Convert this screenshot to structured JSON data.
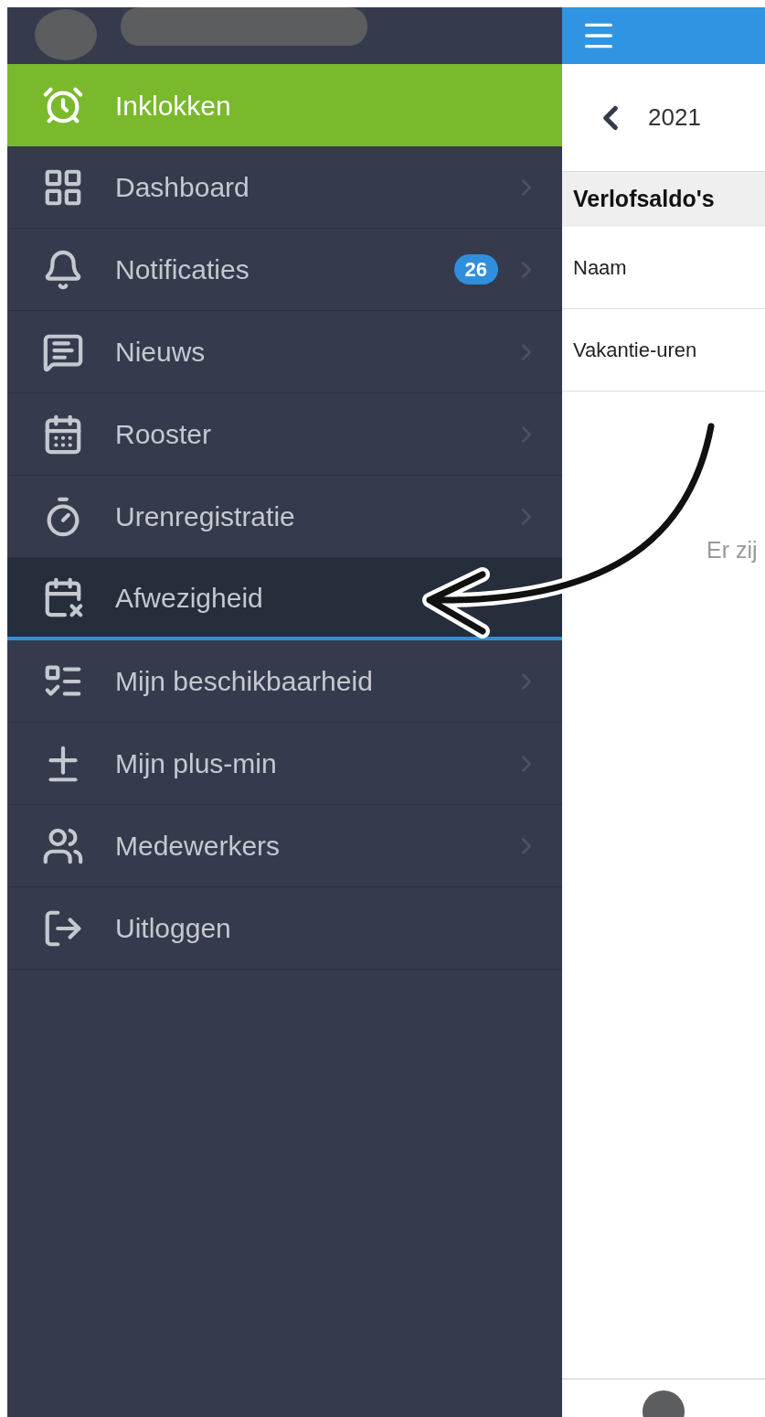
{
  "menu": {
    "items": [
      {
        "kind": "action",
        "label": "Inklokken",
        "selected": false
      },
      {
        "kind": "nav",
        "label": "Dashboard",
        "selected": false
      },
      {
        "kind": "nav",
        "label": "Notificaties",
        "badge": "26",
        "selected": false
      },
      {
        "kind": "nav",
        "label": "Nieuws",
        "selected": false
      },
      {
        "kind": "nav",
        "label": "Rooster",
        "selected": false
      },
      {
        "kind": "nav",
        "label": "Urenregistratie",
        "selected": false
      },
      {
        "kind": "nav",
        "label": "Afwezigheid",
        "selected": true
      },
      {
        "kind": "nav",
        "label": "Mijn beschikbaarheid",
        "selected": false
      },
      {
        "kind": "nav",
        "label": "Mijn plus-min",
        "selected": false
      },
      {
        "kind": "nav",
        "label": "Medewerkers",
        "selected": false
      },
      {
        "kind": "logout",
        "label": "Uitloggen",
        "selected": false
      }
    ]
  },
  "content": {
    "year": "2021",
    "section": "Verlofsaldo's",
    "rows": [
      "Naam",
      "Vakantie-uren"
    ],
    "empty_text": "Er zij"
  }
}
